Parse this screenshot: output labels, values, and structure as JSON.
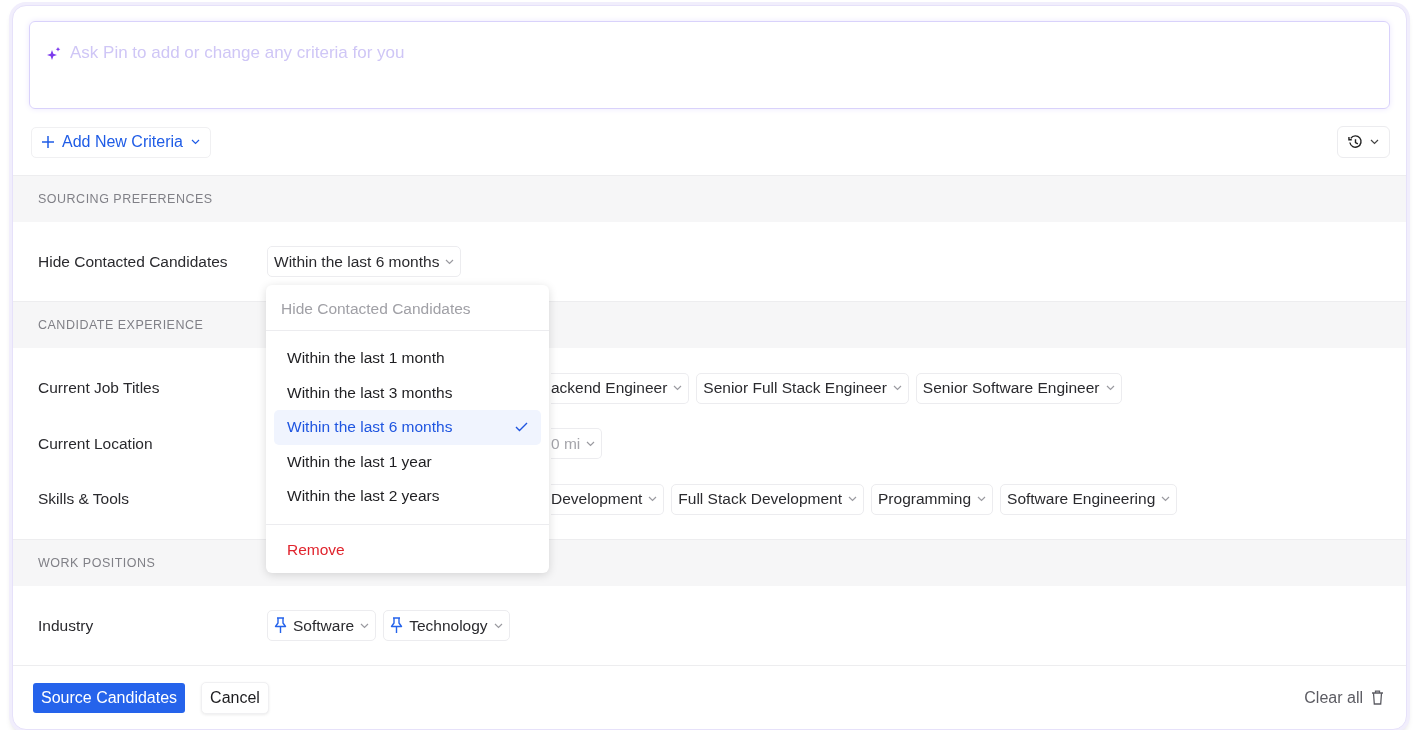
{
  "prompt": {
    "placeholder": "Ask Pin to add or change any criteria for you"
  },
  "toolbar": {
    "add_button": "Add New Criteria"
  },
  "sections": [
    {
      "title": "SOURCING PREFERENCES",
      "rows": [
        {
          "label": "Hide Contacted Candidates",
          "chips": [
            {
              "text": "Within the last 6 months",
              "muted": false,
              "pinned": false,
              "clipped": false
            }
          ]
        }
      ]
    },
    {
      "title": "CANDIDATE EXPERIENCE",
      "rows": [
        {
          "label": "Current Job Titles",
          "chips": [
            {
              "text": "ackend Engineer",
              "muted": false,
              "pinned": false,
              "clipped": true
            },
            {
              "text": "Senior Full Stack Engineer",
              "muted": false,
              "pinned": false,
              "clipped": false
            },
            {
              "text": "Senior Software Engineer",
              "muted": false,
              "pinned": false,
              "clipped": false
            }
          ]
        },
        {
          "label": "Current Location",
          "chips": [
            {
              "text": "0 mi",
              "muted": true,
              "pinned": false,
              "clipped": true
            }
          ]
        },
        {
          "label": "Skills & Tools",
          "chips": [
            {
              "text": "Development",
              "muted": false,
              "pinned": false,
              "clipped": true
            },
            {
              "text": "Full Stack Development",
              "muted": false,
              "pinned": false,
              "clipped": false
            },
            {
              "text": "Programming",
              "muted": false,
              "pinned": false,
              "clipped": false
            },
            {
              "text": "Software Engineering",
              "muted": false,
              "pinned": false,
              "clipped": false
            }
          ]
        }
      ]
    },
    {
      "title": "WORK POSITIONS",
      "rows": [
        {
          "label": "Industry",
          "chips": [
            {
              "text": "Software",
              "muted": false,
              "pinned": true,
              "clipped": false
            },
            {
              "text": "Technology",
              "muted": false,
              "pinned": true,
              "clipped": false
            }
          ]
        }
      ]
    }
  ],
  "dropdown": {
    "title": "Hide Contacted Candidates",
    "options": [
      {
        "label": "Within the last 1 month",
        "selected": false
      },
      {
        "label": "Within the last 3 months",
        "selected": false
      },
      {
        "label": "Within the last 6 months",
        "selected": true
      },
      {
        "label": "Within the last 1 year",
        "selected": false
      },
      {
        "label": "Within the last 2 years",
        "selected": false
      }
    ],
    "remove": "Remove"
  },
  "footer": {
    "primary": "Source Candidates",
    "cancel": "Cancel",
    "clear": "Clear all"
  }
}
